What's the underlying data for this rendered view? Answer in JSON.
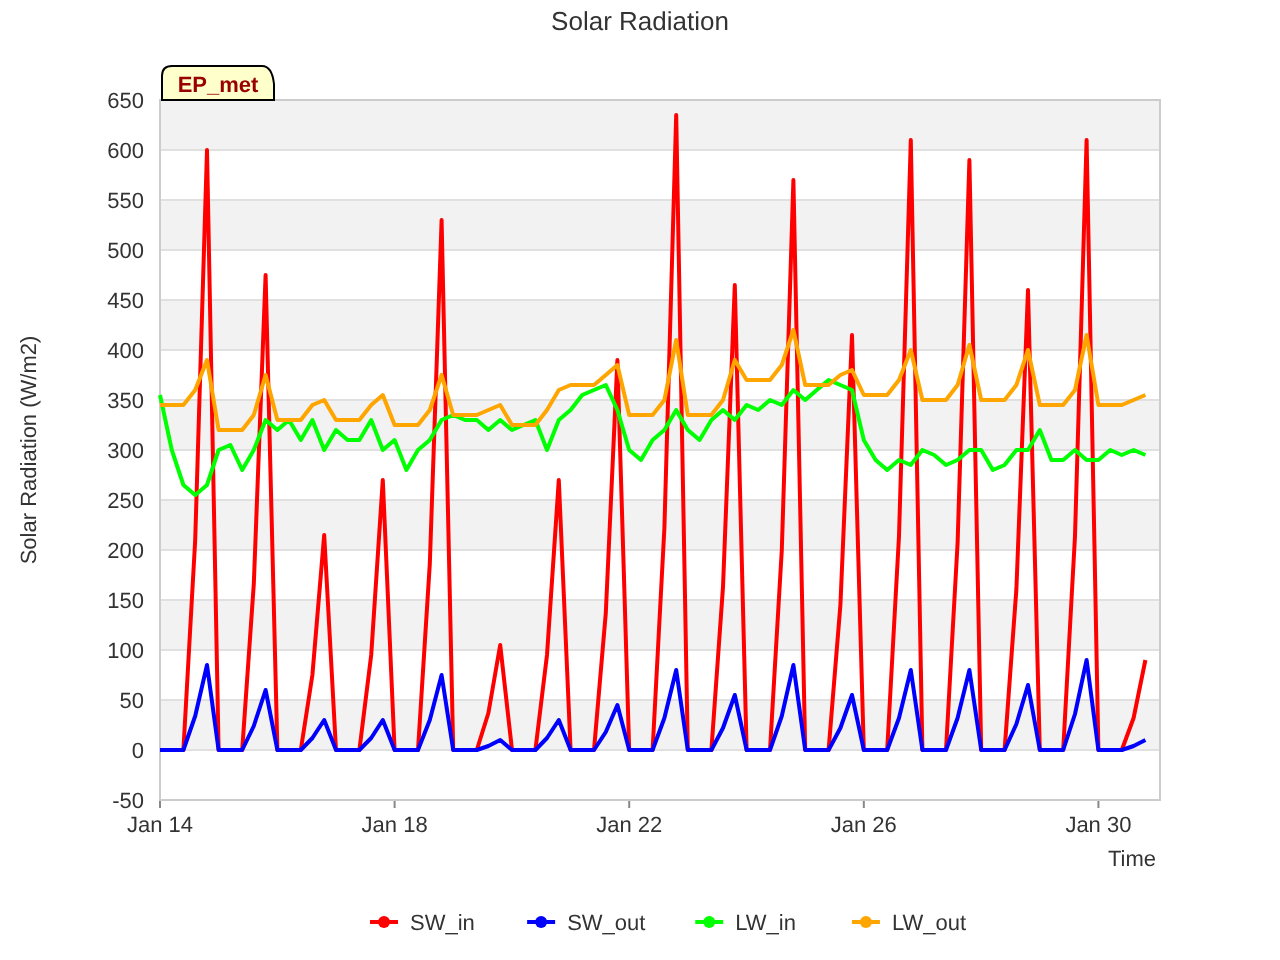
{
  "badge": "EP_met",
  "chart_data": {
    "type": "line",
    "title": "Solar Radiation",
    "xlabel": "Time",
    "ylabel": "Solar Radiation (W/m2)",
    "categories": [
      "Jan 14",
      null,
      null,
      null,
      null,
      null,
      null,
      null,
      null,
      null,
      null,
      null,
      null,
      null,
      null,
      null,
      null,
      null,
      null,
      null,
      "Jan 18",
      null,
      null,
      null,
      null,
      null,
      null,
      null,
      null,
      null,
      null,
      null,
      null,
      null,
      null,
      null,
      null,
      null,
      null,
      null,
      "Jan 22",
      null,
      null,
      null,
      null,
      null,
      null,
      null,
      null,
      null,
      null,
      null,
      null,
      null,
      null,
      null,
      null,
      null,
      null,
      null,
      "Jan 26",
      null,
      null,
      null,
      null,
      null,
      null,
      null,
      null,
      null,
      null,
      null,
      null,
      null,
      null,
      null,
      null,
      null,
      null,
      null,
      "Jan 30",
      null,
      null,
      null,
      null
    ],
    "ylim": [
      -50,
      650
    ],
    "grid": true,
    "legend": "bottom",
    "yticks": [
      -50,
      0,
      50,
      100,
      150,
      200,
      250,
      300,
      350,
      400,
      450,
      500,
      550,
      600,
      650
    ],
    "series": [
      {
        "name": "SW_in",
        "color": "#ff0000",
        "values": [
          0,
          0,
          0,
          210,
          600,
          0,
          0,
          0,
          166,
          475,
          0,
          0,
          0,
          75,
          215,
          0,
          0,
          0,
          95,
          270,
          0,
          0,
          0,
          186,
          530,
          0,
          0,
          0,
          37,
          105,
          0,
          0,
          0,
          95,
          270,
          0,
          0,
          0,
          137,
          390,
          0,
          0,
          0,
          222,
          635,
          0,
          0,
          0,
          163,
          465,
          0,
          0,
          0,
          200,
          570,
          0,
          0,
          0,
          145,
          415,
          0,
          0,
          0,
          214,
          610,
          0,
          0,
          0,
          207,
          590,
          0,
          0,
          0,
          161,
          460,
          0,
          0,
          0,
          214,
          610,
          0,
          0,
          0,
          32,
          90
        ]
      },
      {
        "name": "SW_out",
        "color": "#0000ff",
        "values": [
          0,
          0,
          0,
          34,
          85,
          0,
          0,
          0,
          24,
          60,
          0,
          0,
          0,
          12,
          30,
          0,
          0,
          0,
          12,
          30,
          0,
          0,
          0,
          30,
          75,
          0,
          0,
          0,
          4,
          10,
          0,
          0,
          0,
          12,
          30,
          0,
          0,
          0,
          18,
          45,
          0,
          0,
          0,
          32,
          80,
          0,
          0,
          0,
          22,
          55,
          0,
          0,
          0,
          34,
          85,
          0,
          0,
          0,
          22,
          55,
          0,
          0,
          0,
          32,
          80,
          0,
          0,
          0,
          32,
          80,
          0,
          0,
          0,
          26,
          65,
          0,
          0,
          0,
          36,
          90,
          0,
          0,
          0,
          4,
          10
        ]
      },
      {
        "name": "LW_in",
        "color": "#00ff00",
        "values": [
          355,
          300,
          265,
          255,
          265,
          300,
          305,
          280,
          300,
          330,
          320,
          330,
          310,
          330,
          300,
          320,
          310,
          310,
          330,
          300,
          310,
          280,
          300,
          310,
          330,
          335,
          330,
          330,
          320,
          330,
          320,
          325,
          330,
          300,
          330,
          340,
          355,
          360,
          365,
          340,
          300,
          290,
          310,
          320,
          340,
          320,
          310,
          330,
          340,
          330,
          345,
          340,
          350,
          345,
          360,
          350,
          360,
          370,
          365,
          360,
          310,
          290,
          280,
          290,
          285,
          300,
          295,
          285,
          290,
          300,
          300,
          280,
          285,
          300,
          300,
          320,
          290,
          290,
          300,
          290,
          290,
          300,
          295,
          300,
          295
        ]
      },
      {
        "name": "LW_out",
        "color": "#ffa500",
        "values": [
          345,
          345,
          345,
          360,
          390,
          320,
          320,
          320,
          335,
          375,
          330,
          330,
          330,
          345,
          350,
          330,
          330,
          330,
          345,
          355,
          325,
          325,
          325,
          340,
          375,
          335,
          335,
          335,
          340,
          345,
          325,
          325,
          325,
          340,
          360,
          365,
          365,
          365,
          375,
          385,
          335,
          335,
          335,
          350,
          410,
          335,
          335,
          335,
          350,
          390,
          370,
          370,
          370,
          385,
          420,
          365,
          365,
          365,
          375,
          380,
          355,
          355,
          355,
          370,
          400,
          350,
          350,
          350,
          365,
          405,
          350,
          350,
          350,
          365,
          400,
          345,
          345,
          345,
          360,
          415,
          345,
          345,
          345,
          350,
          355
        ]
      }
    ]
  }
}
